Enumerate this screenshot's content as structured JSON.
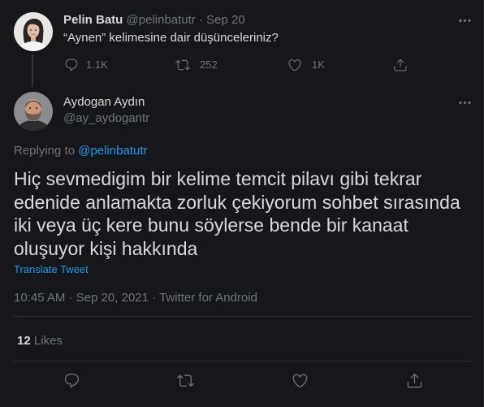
{
  "parent_tweet": {
    "author_name": "Pelin Batu",
    "author_handle": "@pelinbatutr",
    "separator": "·",
    "date": "Sep 20",
    "text": "“Aynen” kelimesine dair düşünceleriniz?",
    "reply_count": "1.1K",
    "retweet_count": "252",
    "like_count": "1K"
  },
  "main_tweet": {
    "author_name": "Aydogan Aydın",
    "author_handle": "@ay_aydogantr",
    "replying_prefix": "Replying to",
    "replying_to": "@pelinbatutr",
    "text_lines": [
      "Hiç sevmedigim bir kelime temcit pilavı gibi tekrar",
      "edenide anlamakta zorluk çekiyorum sohbet sırasında",
      "iki veya üç kere bunu söylerse bende bir kanaat",
      "oluşuyor kişi hakkında"
    ],
    "translate_label": "Translate Tweet",
    "time": "10:45 AM",
    "separator": "·",
    "date": "Sep 20, 2021",
    "source": "Twitter for Android",
    "likes_count": "12",
    "likes_label": "Likes"
  },
  "icons": {
    "more": "more-horizontal-icon",
    "reply": "reply-icon",
    "retweet": "retweet-icon",
    "like": "heart-icon",
    "share": "share-icon"
  },
  "colors": {
    "background": "#15171a",
    "text": "#d9d9d9",
    "muted": "#6e767d",
    "accent": "#1d9bf0",
    "divider": "#2f3336"
  }
}
